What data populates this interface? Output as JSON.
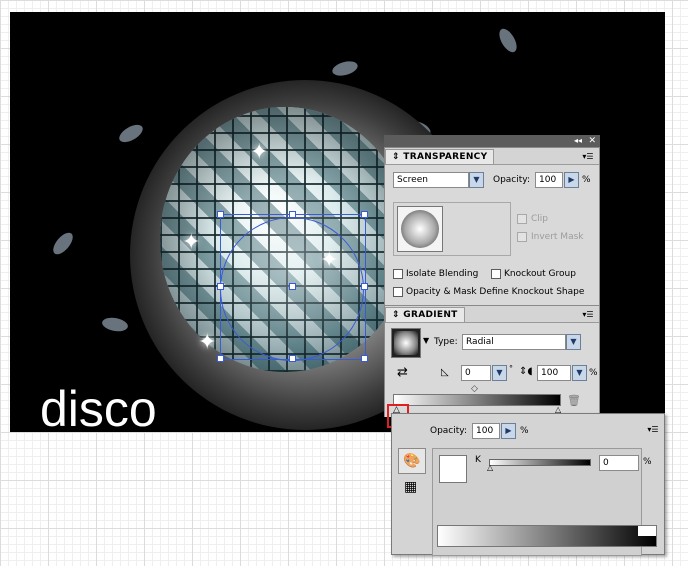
{
  "artwork": {
    "caption": "disco"
  },
  "transparency_panel": {
    "title": "TRANSPARENCY",
    "blend_mode": "Screen",
    "opacity_label": "Opacity:",
    "opacity_value": "100",
    "percent": "%",
    "clip_label": "Clip",
    "invert_mask_label": "Invert Mask",
    "isolate_blending_label": "Isolate Blending",
    "knockout_group_label": "Knockout Group",
    "opacity_mask_label": "Opacity & Mask Define Knockout Shape"
  },
  "gradient_panel": {
    "title": "GRADIENT",
    "type_label": "Type:",
    "type_value": "Radial",
    "angle_value": "0",
    "aspect_value": "100",
    "percent": "%",
    "degree_symbol": "°"
  },
  "color_stop_popup": {
    "opacity_label": "Opacity:",
    "opacity_value": "100",
    "percent": "%",
    "channel_label": "K",
    "channel_value": "0",
    "channel_percent": "%"
  },
  "icons": {
    "panel_collapse": "double-chevron-icon",
    "panel_close": "close-icon",
    "panel_menu": "panel-menu-icon",
    "dropdown": "chevron-down-icon",
    "stepper": "chevron-right-icon",
    "reverse": "reverse-gradient-icon",
    "delete_stop": "trash-icon",
    "swatches": "swatches-icon",
    "color_mode": "color-palette-icon"
  },
  "colors": {
    "selection": "#3a5bd6",
    "highlight": "#e02020",
    "panel_bg": "#d4d4d4"
  }
}
